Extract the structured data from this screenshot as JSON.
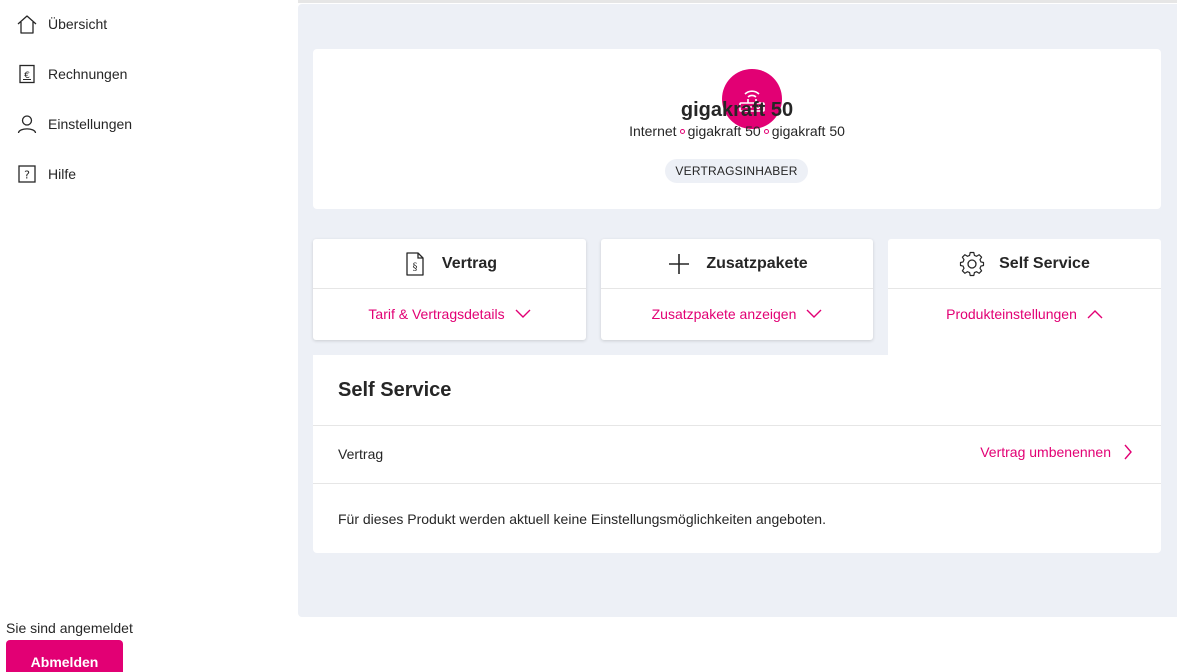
{
  "sidebar": {
    "items": [
      {
        "label": "Übersicht",
        "icon": "home-icon"
      },
      {
        "label": "Rechnungen",
        "icon": "invoice-icon"
      },
      {
        "label": "Einstellungen",
        "icon": "user-icon"
      },
      {
        "label": "Hilfe",
        "icon": "help-icon"
      }
    ],
    "status_text": "Sie sind angemeldet",
    "logout_label": "Abmelden"
  },
  "product": {
    "icon": "router-icon",
    "title": "gigakraft 50",
    "subtitle_parts": [
      "Internet",
      "gigakraft 50",
      "gigakraft 50"
    ],
    "role_badge": "VERTRAGSINHABER"
  },
  "tiles": [
    {
      "label": "Vertrag",
      "icon": "contract-icon",
      "link": "Tarif & Vertragsdetails",
      "expanded": false
    },
    {
      "label": "Zusatzpakete",
      "icon": "plus-icon",
      "link": "Zusatzpakete anzeigen",
      "expanded": false
    },
    {
      "label": "Self Service",
      "icon": "gear-icon",
      "link": "Produkteinstellungen",
      "expanded": true
    }
  ],
  "self_service": {
    "title": "Self Service",
    "row_label": "Vertrag",
    "row_link": "Vertrag umbenennen",
    "note": "Für dieses Produkt werden aktuell keine Einstellungsmöglichkeiten angeboten."
  },
  "colors": {
    "accent": "#e20074",
    "panel_bg": "#edf0f6",
    "text": "#262626"
  }
}
